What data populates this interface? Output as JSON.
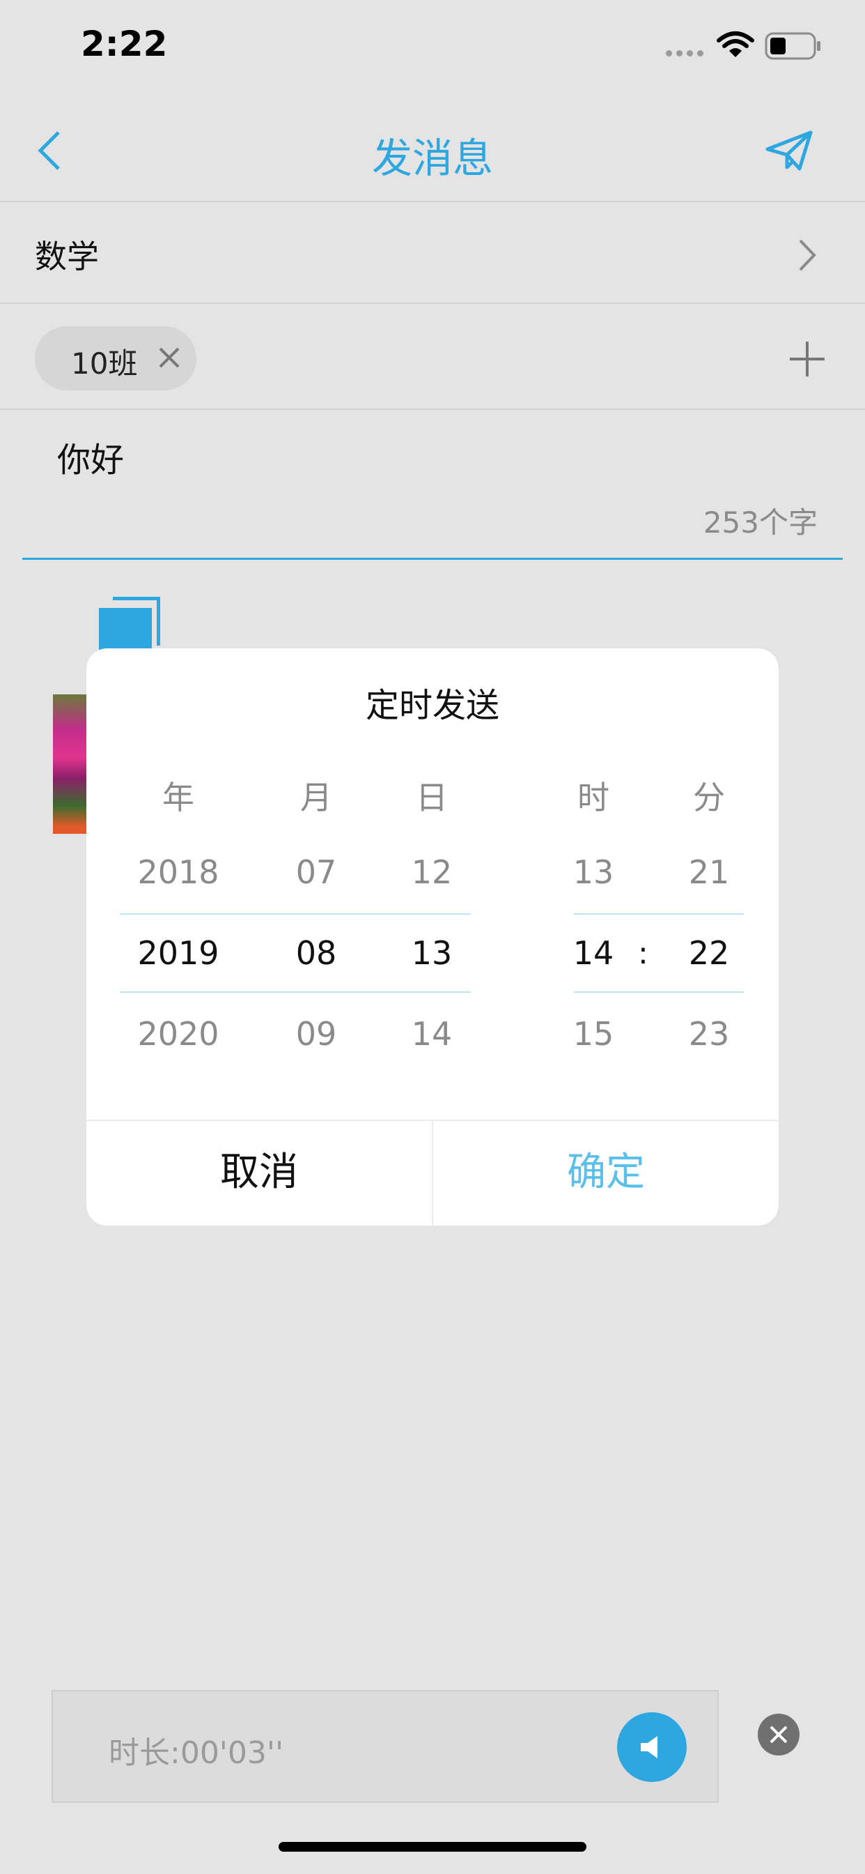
{
  "status_bar": {
    "time": "2:22"
  },
  "nav": {
    "title": "发消息",
    "back_icon": "chevron-left-icon",
    "send_icon": "paper-plane-icon"
  },
  "subject": {
    "label": "数学"
  },
  "recipients": [
    {
      "label": "10班"
    }
  ],
  "message": {
    "text": "你好",
    "char_count": "253个字"
  },
  "audio": {
    "duration": "时长:00'03''"
  },
  "picker": {
    "title": "定时发送",
    "headers": {
      "year": "年",
      "month": "月",
      "day": "日",
      "hour": "时",
      "minute": "分"
    },
    "year": {
      "prev": "2018",
      "selected": "2019",
      "next": "2020"
    },
    "month": {
      "prev": "07",
      "selected": "08",
      "next": "09"
    },
    "day": {
      "prev": "12",
      "selected": "13",
      "next": "14"
    },
    "hour": {
      "prev": "13",
      "selected": "14",
      "next": "15"
    },
    "minute": {
      "prev": "21",
      "selected": "22",
      "next": "23"
    },
    "separator": ":",
    "cancel": "取消",
    "confirm": "确定"
  },
  "colors": {
    "accent": "#2ea7e0",
    "confirm": "#5bbfec",
    "background": "#e4e4e4"
  }
}
